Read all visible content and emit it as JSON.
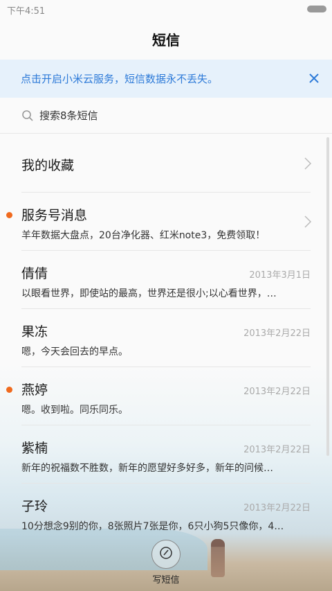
{
  "status_bar": {
    "time": "下午4:51"
  },
  "header": {
    "title": "短信"
  },
  "banner": {
    "text": "点击开启小米云服务，短信数据永不丢失。"
  },
  "search": {
    "placeholder": "搜索8条短信"
  },
  "favorites": {
    "label": "我的收藏"
  },
  "service": {
    "name": "服务号消息",
    "preview": "羊年数据大盘点，20台净化器、红米note3，免费领取！",
    "unread": true
  },
  "threads": [
    {
      "name": "倩倩",
      "date": "2013年3月1日",
      "preview": "以眼看世界，即使站的最高，世界还是很小;以心看世界，…",
      "unread": false
    },
    {
      "name": "果冻",
      "date": "2013年2月22日",
      "preview": "嗯，今天会回去的早点。",
      "unread": false
    },
    {
      "name": "燕婷",
      "date": "2013年2月22日",
      "preview": "嗯。收到啦。同乐同乐。",
      "unread": true
    },
    {
      "name": "紫楠",
      "date": "2013年2月22日",
      "preview": "新年的祝福数不胜数，新年的愿望好多好多，新年的问候…",
      "unread": false
    },
    {
      "name": "子玲",
      "date": "2013年2月22日",
      "preview": "10分想念9别的你，8张照片7张是你，6只小狗5只像你，4…",
      "unread": false
    }
  ],
  "compose": {
    "label": "写短信"
  },
  "colors": {
    "accent": "#2d7ad8",
    "unread_dot": "#f06a1e",
    "banner_bg": "#e6f1fb"
  }
}
